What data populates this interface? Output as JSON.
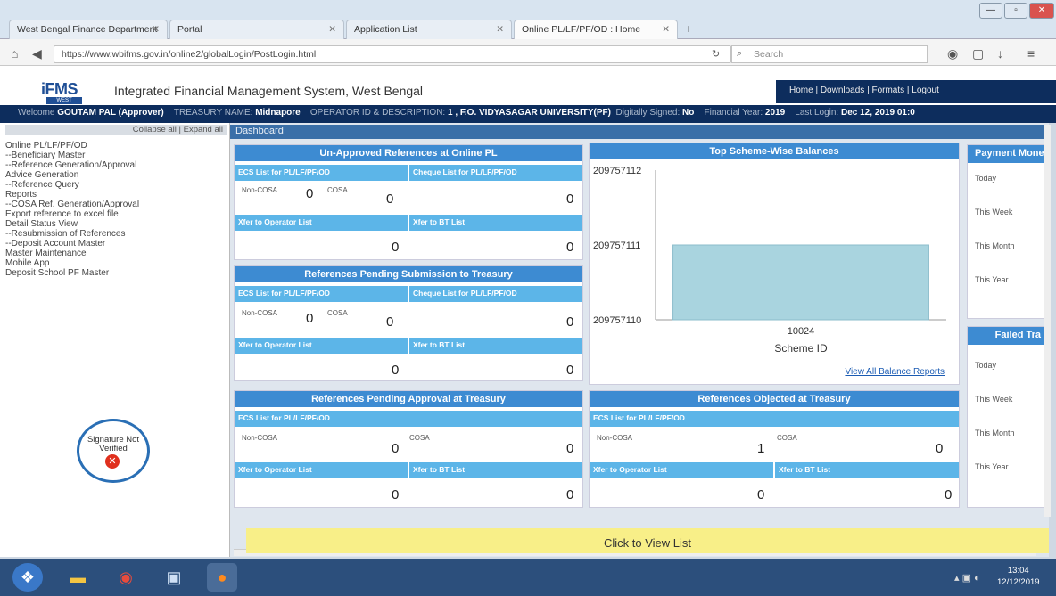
{
  "browser": {
    "tabs": [
      {
        "label": "West Bengal Finance Department",
        "active": false
      },
      {
        "label": "Portal",
        "active": false
      },
      {
        "label": "Application List",
        "active": false
      },
      {
        "label": "Online PL/LF/PF/OD : Home",
        "active": true
      }
    ],
    "new_tab": "+",
    "url": "https://www.wbifms.gov.in/online2/globalLogin/PostLogin.html",
    "search_placeholder": "Search"
  },
  "header": {
    "logo": "iFMS",
    "logo_sub": "WEST BENGAL",
    "title": "Integrated Financial Management System, West Bengal",
    "links": "Home | Downloads | Formats | Logout"
  },
  "infobar": {
    "welcome_label": "Welcome",
    "user": "GOUTAM PAL (Approver)",
    "treasury_label": "TREASURY NAME:",
    "treasury": "Midnapore",
    "operator_label": "OPERATOR ID & DESCRIPTION:",
    "operator": "1 , F.O. VIDYASAGAR UNIVERSITY(PF)",
    "signed_label": "Digitally Signed:",
    "signed": "No",
    "fy_label": "Financial Year:",
    "fy": "2019",
    "login_label": "Last Login:",
    "login": "Dec 12, 2019 01:0"
  },
  "sidebar": {
    "collapse": "Collapse all | Expand all",
    "items": [
      "Online PL/LF/PF/OD",
      "--Beneficiary Master",
      "--Reference Generation/Approval",
      "   Advice Generation",
      "--Reference Query",
      "Reports",
      "--COSA Ref. Generation/Approval",
      "   Export reference to excel file",
      "   Detail Status View",
      "--Resubmission of References",
      "--Deposit Account Master",
      "Master Maintenance",
      "Mobile App",
      "   Deposit School PF Master"
    ],
    "signature": "Signature Not Verified"
  },
  "dashboard": {
    "title": "Dashboard",
    "panel1": {
      "title": "Un-Approved References at Online PL",
      "ecs": "ECS List for PL/LF/PF/OD",
      "cheque": "Cheque List for PL/LF/PF/OD",
      "non_cosa": "Non-COSA",
      "cosa": "COSA",
      "v1": "0",
      "v2": "0",
      "v3": "0",
      "xfer_op": "Xfer to Operator List",
      "xfer_bt": "Xfer to BT List",
      "v4": "0",
      "v5": "0"
    },
    "panel2": {
      "title": "References Pending Submission to Treasury",
      "ecs": "ECS List for PL/LF/PF/OD",
      "cheque": "Cheque List for PL/LF/PF/OD",
      "non_cosa": "Non-COSA",
      "cosa": "COSA",
      "v1": "0",
      "v2": "0",
      "v3": "0",
      "xfer_op": "Xfer to Operator List",
      "xfer_bt": "Xfer to BT List",
      "v4": "0",
      "v5": "0"
    },
    "panel3": {
      "title": "References Pending Approval at Treasury",
      "ecs": "ECS List for PL/LF/PF/OD",
      "non_cosa": "Non-COSA",
      "cosa": "COSA",
      "v1": "0",
      "v2": "0",
      "xfer_op": "Xfer to Operator List",
      "xfer_bt": "Xfer to BT List",
      "v4": "0",
      "v5": "0"
    },
    "panel4": {
      "title": "References Objected at Treasury",
      "ecs": "ECS List for PL/LF/PF/OD",
      "non_cosa": "Non-COSA",
      "cosa": "COSA",
      "v1": "1",
      "v2": "0",
      "xfer_op": "Xfer to Operator List",
      "xfer_bt": "Xfer to BT List",
      "v4": "0",
      "v5": "0"
    },
    "balances": {
      "title": "Top Scheme-Wise Balances",
      "link": "View All Balance Reports"
    },
    "payment": {
      "title": "Payment Mone",
      "rows": [
        "Today",
        "This Week",
        "This Month",
        "This Year"
      ]
    },
    "failed": {
      "title": "Failed Tra",
      "rows": [
        "Today",
        "This Week",
        "This Month",
        "This Year"
      ]
    },
    "click_list": "Click to View List"
  },
  "chart_data": {
    "type": "bar",
    "categories": [
      "10024"
    ],
    "values": [
      209757111
    ],
    "xlabel": "Scheme ID",
    "ylabel": "",
    "yticks": [
      "209757112",
      "209757111",
      "209757110"
    ],
    "ylim": [
      209757110,
      209757112
    ],
    "bar_color": "#a9d4df"
  },
  "taskbar": {
    "time": "13:04",
    "date": "12/12/2019"
  }
}
